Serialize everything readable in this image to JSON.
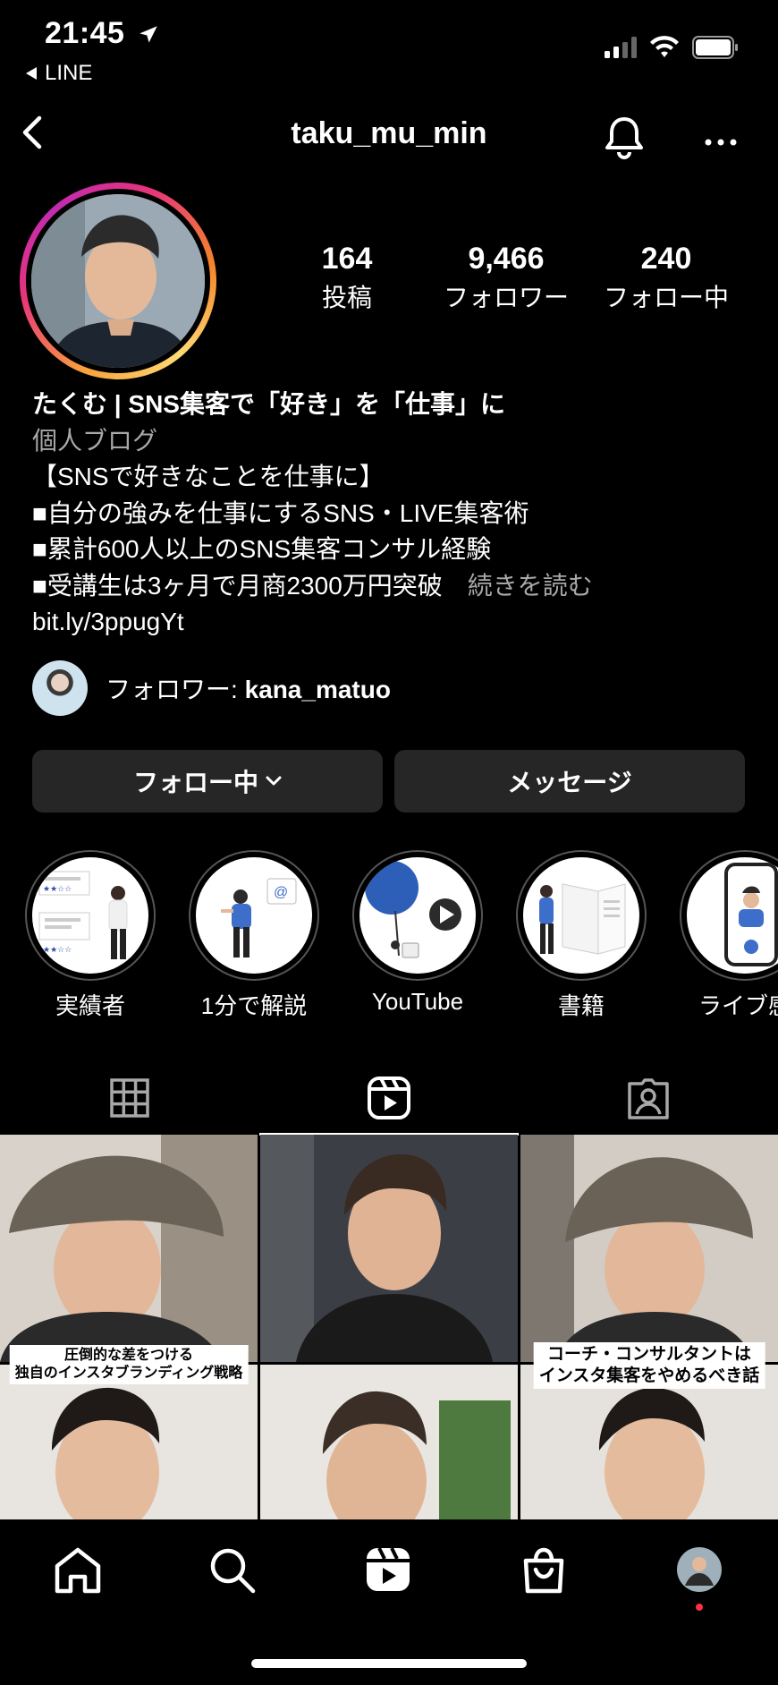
{
  "status_bar": {
    "time": "21:45",
    "back_app": "LINE"
  },
  "header": {
    "username": "taku_mu_min"
  },
  "stats": [
    {
      "value": "164",
      "label": "投稿"
    },
    {
      "value": "9,466",
      "label": "フォロワー"
    },
    {
      "value": "240",
      "label": "フォロー中"
    }
  ],
  "bio": {
    "name": "たくむ | SNS集客で「好き」を「仕事」に",
    "category": "個人ブログ",
    "lines": [
      "【SNSで好きなことを仕事に】",
      "■自分の強みを仕事にするSNS・LIVE集客術",
      "■累計600人以上のSNS集客コンサル経験",
      "■受講生は3ヶ月で月商2300万円突破"
    ],
    "more": "続きを読む",
    "link": "bit.ly/3ppugYt"
  },
  "followed_by": {
    "prefix": "フォロワー: ",
    "user": "kana_matuo"
  },
  "buttons": {
    "following": "フォロー中",
    "message": "メッセージ"
  },
  "highlights": [
    {
      "label": "実績者"
    },
    {
      "label": "1分で解説"
    },
    {
      "label": "YouTube"
    },
    {
      "label": "書籍"
    },
    {
      "label": "ライブ感"
    }
  ],
  "tabs": {
    "active": "reels"
  },
  "grid": {
    "captions": [
      [
        "圧倒的な差をつける",
        "独自のインスタブランディング戦略"
      ],
      [
        "コーチ・コンサルタントは",
        "インスタ集客をやめるべき話"
      ]
    ]
  },
  "colors": {
    "background": "#000000",
    "button": "#262626",
    "muted": "#a8a8a8",
    "notification_dot": "#ff3040"
  }
}
